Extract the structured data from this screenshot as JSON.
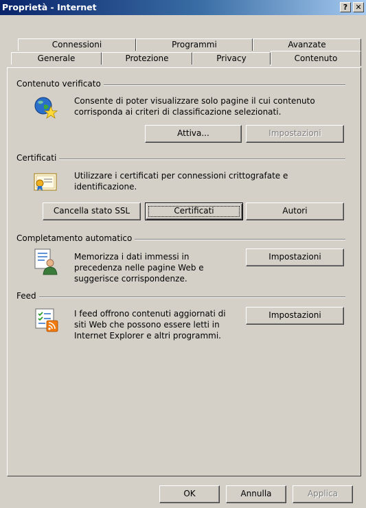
{
  "window": {
    "title": "Proprietà - Internet",
    "help_label": "?",
    "close_label": "✕"
  },
  "tabs": {
    "row1": [
      "Connessioni",
      "Programmi",
      "Avanzate"
    ],
    "row2": [
      "Generale",
      "Protezione",
      "Privacy",
      "Contenuto"
    ],
    "active": "Contenuto"
  },
  "content_advisor": {
    "group_label": "Contenuto verificato",
    "description_line1": "Consente di poter visualizzare solo pagine il cui contenuto",
    "description_line2": "corrisponda ai criteri di classificazione selezionati.",
    "enable_label": "Attiva...",
    "settings_label": "Impostazioni"
  },
  "certificates": {
    "group_label": "Certificati",
    "description_line1": "Utilizzare i certificati per connessioni crittografate e",
    "description_line2": "identificazione.",
    "clear_ssl_label": "Cancella stato SSL",
    "certificates_label": "Certificati",
    "publishers_label": "Autori"
  },
  "autocomplete": {
    "group_label": "Completamento automatico",
    "description_line1": "Memorizza i dati immessi in",
    "description_line2": "precedenza nelle pagine Web e",
    "description_line3": "suggerisce corrispondenze.",
    "settings_label": "Impostazioni"
  },
  "feeds": {
    "group_label": "Feed",
    "description_line1": "I feed offrono contenuti aggiornati di",
    "description_line2": "siti Web che possono essere letti in",
    "description_line3": "Internet Explorer e altri programmi.",
    "settings_label": "Impostazioni"
  },
  "footer": {
    "ok_label": "OK",
    "cancel_label": "Annulla",
    "apply_label": "Applica"
  },
  "icons": {
    "content_advisor": "globe-star-icon",
    "certificates": "certificate-icon",
    "autocomplete": "autocomplete-user-icon",
    "feeds": "rss-feed-icon"
  }
}
